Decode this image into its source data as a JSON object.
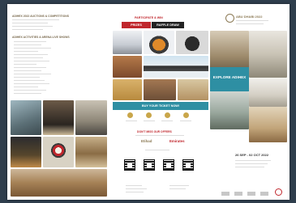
{
  "left": {
    "heading1": "ADIHEX 2022 AUCTIONS & COMPETITIONS",
    "heading2": "ADIHEX ACTIVITIES & ARENA LIVE SHOWS"
  },
  "center": {
    "kicker": "PARTICIPATE & WIN",
    "prizes_label": "PRIZES",
    "raffle_label": "RAFFLE DRAW",
    "ticket_button": "BUY YOUR TICKET NOW!",
    "dont_miss": "DON'T MISS OUR OFFERS",
    "partner": "Etihad",
    "sponsor": "Emirates"
  },
  "right": {
    "brand_line": "ABU DHABI 2022",
    "explore_title": "EXPLORE ADIHEX",
    "dates": "26 SEP - 02 OCT 2022"
  },
  "colors": {
    "accent_red": "#c0272d",
    "dark_label": "#222222",
    "teal": "#2e8fa3",
    "gold": "#8c7a55"
  }
}
